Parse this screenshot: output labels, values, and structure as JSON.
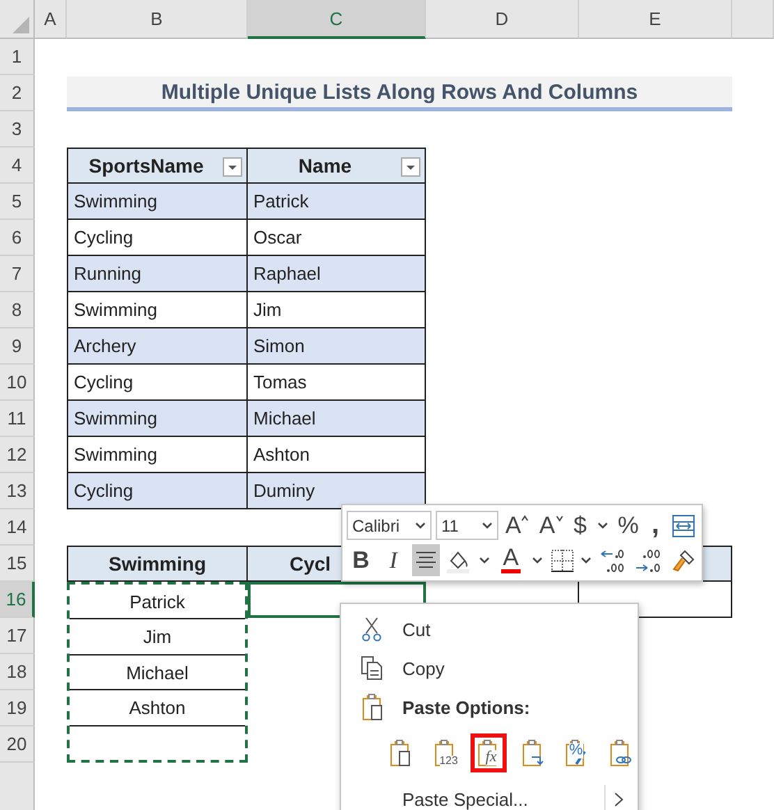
{
  "column_headers": [
    {
      "label": "A",
      "selected": false
    },
    {
      "label": "B",
      "selected": false
    },
    {
      "label": "C",
      "selected": true
    },
    {
      "label": "D",
      "selected": false
    },
    {
      "label": "E",
      "selected": false
    }
  ],
  "row_headers": [
    {
      "label": "1",
      "selected": false
    },
    {
      "label": "2",
      "selected": false
    },
    {
      "label": "3",
      "selected": false
    },
    {
      "label": "4",
      "selected": false
    },
    {
      "label": "5",
      "selected": false
    },
    {
      "label": "6",
      "selected": false
    },
    {
      "label": "7",
      "selected": false
    },
    {
      "label": "8",
      "selected": false
    },
    {
      "label": "9",
      "selected": false
    },
    {
      "label": "10",
      "selected": false
    },
    {
      "label": "11",
      "selected": false
    },
    {
      "label": "12",
      "selected": false
    },
    {
      "label": "13",
      "selected": false
    },
    {
      "label": "14",
      "selected": false
    },
    {
      "label": "15",
      "selected": false
    },
    {
      "label": "16",
      "selected": true
    },
    {
      "label": "17",
      "selected": false
    },
    {
      "label": "18",
      "selected": false
    },
    {
      "label": "19",
      "selected": false
    },
    {
      "label": "20",
      "selected": false
    }
  ],
  "title": "Multiple Unique Lists Along Rows And Columns",
  "sports_table": {
    "columns": [
      "SportsName",
      "Name"
    ],
    "rows": [
      [
        "Swimming",
        "Patrick"
      ],
      [
        "Cycling",
        "Oscar"
      ],
      [
        "Running",
        "Raphael"
      ],
      [
        "Swimming",
        "Jim"
      ],
      [
        "Archery",
        "Simon"
      ],
      [
        "Cycling",
        "Tomas"
      ],
      [
        "Swimming",
        "Michael"
      ],
      [
        "Swimming",
        "Ashton"
      ],
      [
        "Cycling",
        "Duminy"
      ]
    ]
  },
  "unique_lists": {
    "columns": [
      "Swimming",
      "Cycl"
    ],
    "values": [
      "Patrick",
      "Jim",
      "Michael",
      "Ashton"
    ],
    "copied": true
  },
  "mini_toolbar": {
    "font_controls": [
      {
        "kind": "font",
        "value": "Calibri"
      },
      {
        "kind": "size",
        "value": "11"
      },
      {
        "kind": "grow",
        "label": "A"
      },
      {
        "kind": "shrink",
        "label": "A"
      },
      {
        "kind": "text",
        "label": "$"
      },
      {
        "kind": "dropdown"
      },
      {
        "kind": "text",
        "label": "%"
      },
      {
        "kind": "comma",
        "label": ","
      },
      {
        "kind": "wrap"
      }
    ],
    "format_controls": [
      {
        "kind": "bold",
        "label": "B",
        "pressed": false
      },
      {
        "kind": "italic",
        "label": "I",
        "pressed": false
      },
      {
        "kind": "align",
        "pressed": true
      },
      {
        "kind": "fill"
      },
      {
        "kind": "dropdown"
      },
      {
        "kind": "font-color",
        "label": "A"
      },
      {
        "kind": "dropdown"
      },
      {
        "kind": "borders"
      },
      {
        "kind": "dropdown"
      },
      {
        "kind": "decrease-decimal"
      },
      {
        "kind": "increase-decimal"
      },
      {
        "kind": "painter"
      }
    ]
  },
  "context_menu": {
    "items": [
      {
        "kind": "cut",
        "label": "Cut"
      },
      {
        "kind": "copy",
        "label": "Copy"
      },
      {
        "kind": "header",
        "label": "Paste Options:"
      },
      {
        "kind": "paste-options",
        "options": [
          {
            "kind": "paste",
            "selected": false
          },
          {
            "kind": "values",
            "label": "123",
            "selected": false
          },
          {
            "kind": "formulas",
            "label": "fx",
            "selected": true
          },
          {
            "kind": "transpose",
            "selected": false
          },
          {
            "kind": "formatting",
            "label": "%",
            "selected": false
          },
          {
            "kind": "link",
            "selected": false
          }
        ]
      },
      {
        "kind": "submenu",
        "label": "Paste Special..."
      }
    ]
  }
}
